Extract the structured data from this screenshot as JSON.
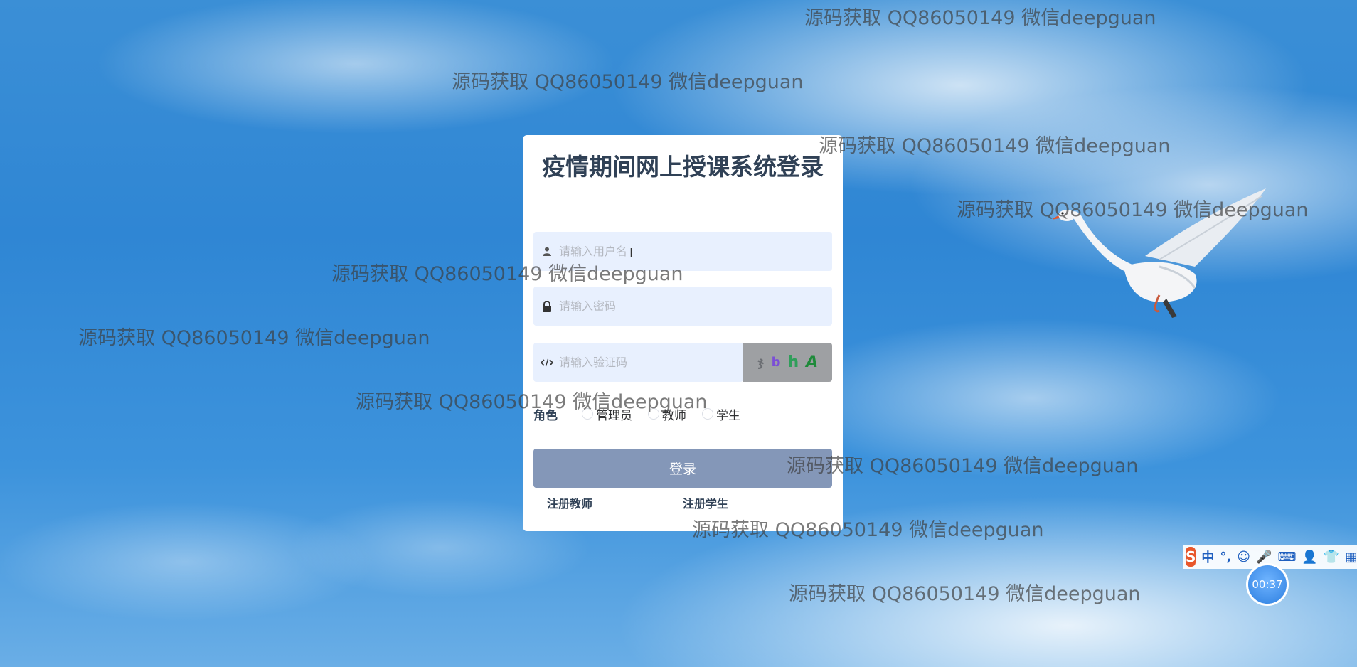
{
  "login": {
    "title": "疫情期间网上授课系统登录",
    "username_placeholder": "请输入用户名",
    "password_placeholder": "请输入密码",
    "captcha_placeholder": "请输入验证码",
    "captcha_chars": [
      "ჯ",
      "b",
      "h",
      "A"
    ],
    "captcha_colors": [
      "#6b6e73",
      "#7b4fd6",
      "#2f9e5a",
      "#1e8a3a"
    ],
    "role_label": "角色",
    "roles": [
      "管理员",
      "教师",
      "学生"
    ],
    "submit_label": "登录",
    "register_teacher": "注册教师",
    "register_student": "注册学生",
    "icons": {
      "username": "user-icon",
      "password": "lock-icon",
      "captcha": "code-icon"
    }
  },
  "watermark_text": "源码获取 QQ86050149 微信deepguan",
  "ime": {
    "logo": "S",
    "items": [
      "中",
      "°,",
      "☺",
      "🎤",
      "⌨",
      "👤",
      "👕",
      "▦"
    ]
  },
  "timer": "00:37",
  "colors": {
    "sky": "#2f86d4",
    "card": "#ffffff",
    "input_bg": "#e8f0fe",
    "button": "#8497b8",
    "title": "#304156"
  }
}
